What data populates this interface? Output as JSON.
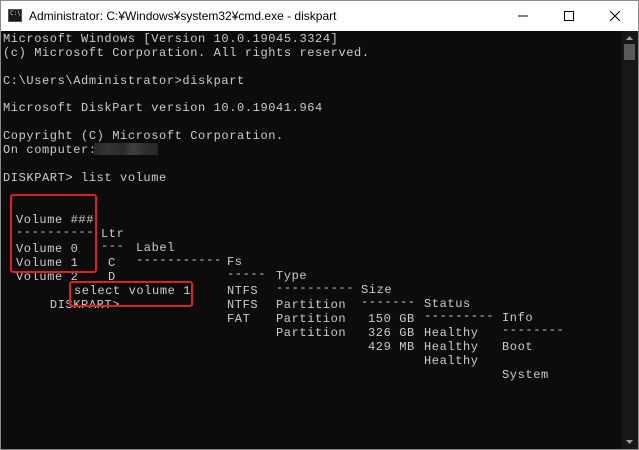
{
  "window": {
    "title": "Administrator: C:¥Windows¥system32¥cmd.exe - diskpart",
    "icon_text": "C:\\."
  },
  "console": {
    "lines": [
      "Microsoft Windows [Version 10.0.19045.3324]",
      "(c) Microsoft Corporation. All rights reserved.",
      "C:\\Users\\Administrator>diskpart",
      "Microsoft DiskPart version 10.0.19041.964",
      "Copyright (C) Microsoft Corporation.",
      "On computer:",
      "DISKPART> list volume"
    ],
    "prompt": "DISKPART>",
    "command": "select volume 1"
  },
  "volume_table": {
    "headers": [
      "Volume ###",
      "Ltr",
      "Label",
      "Fs",
      "Type",
      "Size",
      "Status",
      "Info"
    ],
    "separators": [
      "----------",
      "---",
      "-----------",
      "-----",
      "----------",
      "-------",
      "---------",
      "--------"
    ],
    "rows": [
      [
        "Volume 0",
        "C",
        "",
        "NTFS",
        "Partition",
        "150 GB",
        "Healthy",
        "Boot"
      ],
      [
        "Volume 1",
        "D",
        "",
        "NTFS",
        "Partition",
        "326 GB",
        "Healthy",
        ""
      ],
      [
        "Volume 2",
        "",
        "",
        "FAT",
        "Partition",
        "429 MB",
        "Healthy",
        "System"
      ]
    ]
  },
  "colors": {
    "console_bg": "#0c0c0c",
    "console_text": "#cccccc",
    "highlight": "#e02020"
  }
}
